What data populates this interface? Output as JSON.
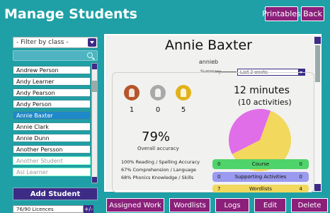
{
  "header": {
    "title": "Manage Students",
    "printables_label": "Printables",
    "back_label": "Back"
  },
  "sidebar": {
    "filter_label": "- Filter by class -",
    "search_placeholder": "",
    "students": [
      "Andrew Person",
      "Andy Learner",
      "Andy Pearson",
      "Andy Person",
      "Annie Baxter",
      "Annie Clark",
      "Annie Dunn",
      "Another Persson",
      "Another Student",
      "Asl Learner"
    ],
    "selected_student": "Annie Baxter",
    "add_student_label": "Add Student",
    "licences": "76/90 Licences",
    "licences_button": "+/-"
  },
  "student": {
    "name": "Annie Baxter",
    "username": "annieb",
    "summary_label": "Summary",
    "range_value": "Last 2 weeks",
    "medals": [
      {
        "type": "bronze",
        "count": "1",
        "color": "#b5562a"
      },
      {
        "type": "silver",
        "count": "0",
        "color": "#a9a9a9"
      },
      {
        "type": "gold",
        "count": "5",
        "color": "#e2b21a"
      }
    ],
    "minutes": "12 minutes",
    "activities": "(10 activities)",
    "accuracy": "79%",
    "accuracy_label": "Overall accuracy",
    "stats": [
      "100% Reading / Spelling Accuracy",
      "67% Comprehension / Language",
      "68% Phonics Knowledge / Skills"
    ],
    "pie": {
      "slices": [
        {
          "value": 0.62,
          "color": "#f2d85c"
        },
        {
          "value": 0.38,
          "color": "#e06ee8"
        }
      ]
    },
    "breakdown": [
      {
        "label": "Course",
        "left": "0",
        "right": "0",
        "color": "#4fd36b"
      },
      {
        "label": "Supporting Activities",
        "left": "0",
        "right": "0",
        "color": "#9a9af0"
      },
      {
        "label": "Wordlists",
        "left": "7",
        "right": "4",
        "color": "#f2d85c"
      }
    ]
  },
  "toolbar": {
    "assigned_work": "Assigned Work",
    "wordlists": "Wordlists",
    "logs": "Logs",
    "edit": "Edit",
    "delete": "Delete"
  }
}
